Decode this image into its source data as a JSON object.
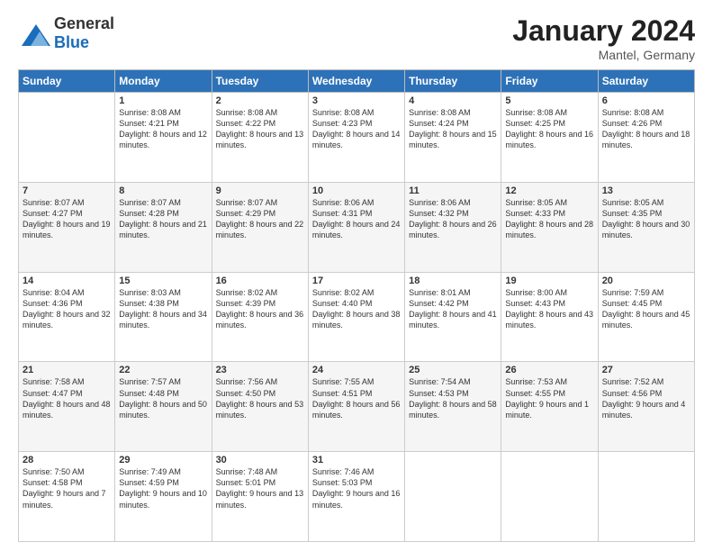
{
  "header": {
    "logo_general": "General",
    "logo_blue": "Blue",
    "title": "January 2024",
    "location": "Mantel, Germany"
  },
  "days_of_week": [
    "Sunday",
    "Monday",
    "Tuesday",
    "Wednesday",
    "Thursday",
    "Friday",
    "Saturday"
  ],
  "weeks": [
    [
      {
        "num": "",
        "sunrise": "",
        "sunset": "",
        "daylight": ""
      },
      {
        "num": "1",
        "sunrise": "Sunrise: 8:08 AM",
        "sunset": "Sunset: 4:21 PM",
        "daylight": "Daylight: 8 hours and 12 minutes."
      },
      {
        "num": "2",
        "sunrise": "Sunrise: 8:08 AM",
        "sunset": "Sunset: 4:22 PM",
        "daylight": "Daylight: 8 hours and 13 minutes."
      },
      {
        "num": "3",
        "sunrise": "Sunrise: 8:08 AM",
        "sunset": "Sunset: 4:23 PM",
        "daylight": "Daylight: 8 hours and 14 minutes."
      },
      {
        "num": "4",
        "sunrise": "Sunrise: 8:08 AM",
        "sunset": "Sunset: 4:24 PM",
        "daylight": "Daylight: 8 hours and 15 minutes."
      },
      {
        "num": "5",
        "sunrise": "Sunrise: 8:08 AM",
        "sunset": "Sunset: 4:25 PM",
        "daylight": "Daylight: 8 hours and 16 minutes."
      },
      {
        "num": "6",
        "sunrise": "Sunrise: 8:08 AM",
        "sunset": "Sunset: 4:26 PM",
        "daylight": "Daylight: 8 hours and 18 minutes."
      }
    ],
    [
      {
        "num": "7",
        "sunrise": "Sunrise: 8:07 AM",
        "sunset": "Sunset: 4:27 PM",
        "daylight": "Daylight: 8 hours and 19 minutes."
      },
      {
        "num": "8",
        "sunrise": "Sunrise: 8:07 AM",
        "sunset": "Sunset: 4:28 PM",
        "daylight": "Daylight: 8 hours and 21 minutes."
      },
      {
        "num": "9",
        "sunrise": "Sunrise: 8:07 AM",
        "sunset": "Sunset: 4:29 PM",
        "daylight": "Daylight: 8 hours and 22 minutes."
      },
      {
        "num": "10",
        "sunrise": "Sunrise: 8:06 AM",
        "sunset": "Sunset: 4:31 PM",
        "daylight": "Daylight: 8 hours and 24 minutes."
      },
      {
        "num": "11",
        "sunrise": "Sunrise: 8:06 AM",
        "sunset": "Sunset: 4:32 PM",
        "daylight": "Daylight: 8 hours and 26 minutes."
      },
      {
        "num": "12",
        "sunrise": "Sunrise: 8:05 AM",
        "sunset": "Sunset: 4:33 PM",
        "daylight": "Daylight: 8 hours and 28 minutes."
      },
      {
        "num": "13",
        "sunrise": "Sunrise: 8:05 AM",
        "sunset": "Sunset: 4:35 PM",
        "daylight": "Daylight: 8 hours and 30 minutes."
      }
    ],
    [
      {
        "num": "14",
        "sunrise": "Sunrise: 8:04 AM",
        "sunset": "Sunset: 4:36 PM",
        "daylight": "Daylight: 8 hours and 32 minutes."
      },
      {
        "num": "15",
        "sunrise": "Sunrise: 8:03 AM",
        "sunset": "Sunset: 4:38 PM",
        "daylight": "Daylight: 8 hours and 34 minutes."
      },
      {
        "num": "16",
        "sunrise": "Sunrise: 8:02 AM",
        "sunset": "Sunset: 4:39 PM",
        "daylight": "Daylight: 8 hours and 36 minutes."
      },
      {
        "num": "17",
        "sunrise": "Sunrise: 8:02 AM",
        "sunset": "Sunset: 4:40 PM",
        "daylight": "Daylight: 8 hours and 38 minutes."
      },
      {
        "num": "18",
        "sunrise": "Sunrise: 8:01 AM",
        "sunset": "Sunset: 4:42 PM",
        "daylight": "Daylight: 8 hours and 41 minutes."
      },
      {
        "num": "19",
        "sunrise": "Sunrise: 8:00 AM",
        "sunset": "Sunset: 4:43 PM",
        "daylight": "Daylight: 8 hours and 43 minutes."
      },
      {
        "num": "20",
        "sunrise": "Sunrise: 7:59 AM",
        "sunset": "Sunset: 4:45 PM",
        "daylight": "Daylight: 8 hours and 45 minutes."
      }
    ],
    [
      {
        "num": "21",
        "sunrise": "Sunrise: 7:58 AM",
        "sunset": "Sunset: 4:47 PM",
        "daylight": "Daylight: 8 hours and 48 minutes."
      },
      {
        "num": "22",
        "sunrise": "Sunrise: 7:57 AM",
        "sunset": "Sunset: 4:48 PM",
        "daylight": "Daylight: 8 hours and 50 minutes."
      },
      {
        "num": "23",
        "sunrise": "Sunrise: 7:56 AM",
        "sunset": "Sunset: 4:50 PM",
        "daylight": "Daylight: 8 hours and 53 minutes."
      },
      {
        "num": "24",
        "sunrise": "Sunrise: 7:55 AM",
        "sunset": "Sunset: 4:51 PM",
        "daylight": "Daylight: 8 hours and 56 minutes."
      },
      {
        "num": "25",
        "sunrise": "Sunrise: 7:54 AM",
        "sunset": "Sunset: 4:53 PM",
        "daylight": "Daylight: 8 hours and 58 minutes."
      },
      {
        "num": "26",
        "sunrise": "Sunrise: 7:53 AM",
        "sunset": "Sunset: 4:55 PM",
        "daylight": "Daylight: 9 hours and 1 minute."
      },
      {
        "num": "27",
        "sunrise": "Sunrise: 7:52 AM",
        "sunset": "Sunset: 4:56 PM",
        "daylight": "Daylight: 9 hours and 4 minutes."
      }
    ],
    [
      {
        "num": "28",
        "sunrise": "Sunrise: 7:50 AM",
        "sunset": "Sunset: 4:58 PM",
        "daylight": "Daylight: 9 hours and 7 minutes."
      },
      {
        "num": "29",
        "sunrise": "Sunrise: 7:49 AM",
        "sunset": "Sunset: 4:59 PM",
        "daylight": "Daylight: 9 hours and 10 minutes."
      },
      {
        "num": "30",
        "sunrise": "Sunrise: 7:48 AM",
        "sunset": "Sunset: 5:01 PM",
        "daylight": "Daylight: 9 hours and 13 minutes."
      },
      {
        "num": "31",
        "sunrise": "Sunrise: 7:46 AM",
        "sunset": "Sunset: 5:03 PM",
        "daylight": "Daylight: 9 hours and 16 minutes."
      },
      {
        "num": "",
        "sunrise": "",
        "sunset": "",
        "daylight": ""
      },
      {
        "num": "",
        "sunrise": "",
        "sunset": "",
        "daylight": ""
      },
      {
        "num": "",
        "sunrise": "",
        "sunset": "",
        "daylight": ""
      }
    ]
  ]
}
